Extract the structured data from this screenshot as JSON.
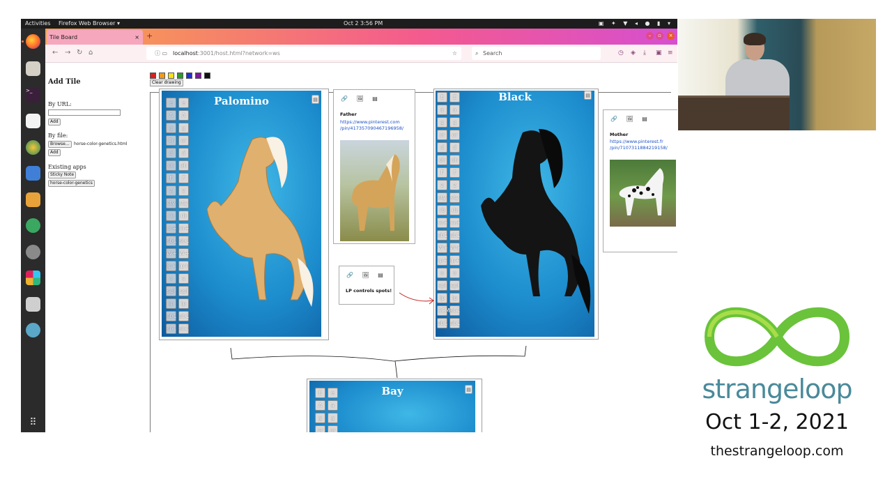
{
  "desktop": {
    "activities": "Activities",
    "app_menu": "Firefox Web Browser ▾",
    "clock": "Oct 2  3:56 PM",
    "system_icons": "▣ ✦ ▼ ◂ ● ▮ ▾"
  },
  "browser": {
    "tab_title": "Tile Board",
    "tab_close": "×",
    "new_tab": "+",
    "url_host": "localhost",
    "url_rest": ":3001/host.html?network=ws",
    "search_placeholder": "Search"
  },
  "left_panel": {
    "heading": "Add Tile",
    "by_url_label": "By URL:",
    "add_label": "Add",
    "by_file_label": "By file:",
    "browse_label": "Browse...",
    "file_name": "horse-color-genetics.html",
    "existing_label": "Existing apps",
    "apps": [
      "Sticky Note",
      "horse-color-genetics"
    ]
  },
  "drawing": {
    "colors": [
      "#d92020",
      "#f09a1c",
      "#f2e21d",
      "#2e9a2e",
      "#2430d0",
      "#7a1a9a",
      "#111111"
    ],
    "clear_label": "Clear drawing"
  },
  "cards": {
    "palomino": {
      "title": "Palomino",
      "left": [
        "e",
        "A",
        "g",
        "Cr",
        "d",
        "ch",
        "F",
        "z",
        "sty",
        "rb",
        "m+",
        "sb1",
        "W+",
        "lp+",
        "o",
        "spl",
        "lp",
        "sb1",
        "sb1"
      ],
      "right": [
        "e",
        "A",
        "g",
        "cr",
        "d",
        "ch",
        "F",
        "z",
        "sty",
        "rb",
        "m+",
        "sb1",
        "W+",
        "lp+",
        "o",
        "spl",
        "lp",
        "sb1",
        "sb1"
      ]
    },
    "black": {
      "title": "Black",
      "left": [
        "E",
        "a",
        "g",
        "cr",
        "d",
        "ch",
        "F",
        "z",
        "sty",
        "rb",
        "m+",
        "sb1",
        "W+",
        "lp+",
        "o",
        "spl",
        "lp",
        "SCM",
        "sb1"
      ],
      "right": [
        "E",
        "a",
        "g",
        "cr",
        "d",
        "ch",
        "F",
        "z",
        "sty",
        "rb",
        "m+",
        "sb1",
        "W+",
        "lp+",
        "o",
        "spl",
        "lp",
        "sb1",
        "sb1"
      ]
    },
    "bay": {
      "title": "Bay",
      "left": [
        "E",
        "A",
        "g",
        "cr"
      ],
      "right": [
        "e",
        "a",
        "g",
        "cr"
      ]
    }
  },
  "notes": {
    "father": {
      "tools": "🔗 🖼 ▤",
      "head": "Father",
      "link1": "https://www.pinterest.com",
      "link2": "/pin/417357090467196958/"
    },
    "mother": {
      "tools": "🔗 🖼 ▤",
      "head": "Mother",
      "link1": "https://www.pinterest.fr",
      "link2": "/pin/710731188421915​8/"
    },
    "lp": {
      "tools": "🔗 🖼 ▤",
      "head": "LP controls spots!"
    }
  },
  "brand": {
    "name": "strangeloop",
    "dates": "Oct 1-2, 2021",
    "url": "thestrangeloop.com"
  }
}
